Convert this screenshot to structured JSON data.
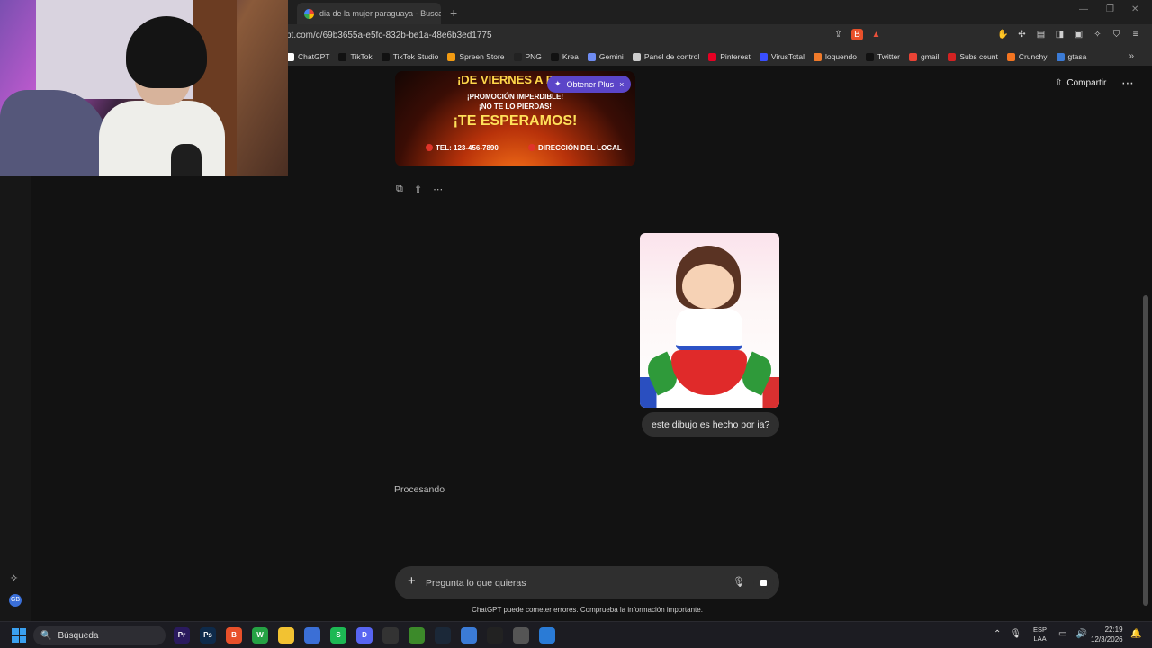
{
  "browser": {
    "tab_title": "dia de la mujer paraguaya - Buscar c",
    "new_tab": "+",
    "url": "pt.com/c/69b3655a-e5fc-832b-be1a-48e6b3ed1775",
    "bookmarks": [
      {
        "label": "ChatGPT",
        "color": "#ffffff"
      },
      {
        "label": "TikTok",
        "color": "#111111"
      },
      {
        "label": "TikTok Studio",
        "color": "#111111"
      },
      {
        "label": "Spreen Store",
        "color": "#f29b12"
      },
      {
        "label": "PNG",
        "color": "#222222"
      },
      {
        "label": "Krea",
        "color": "#111111"
      },
      {
        "label": "Gemini",
        "color": "#6f8cf2"
      },
      {
        "label": "Panel de control",
        "color": "#cccccc"
      },
      {
        "label": "Pinterest",
        "color": "#e60023"
      },
      {
        "label": "VirusTotal",
        "color": "#394eff"
      },
      {
        "label": "loquendo",
        "color": "#f07a2a"
      },
      {
        "label": "Twitter",
        "color": "#111111"
      },
      {
        "label": "gmail",
        "color": "#ea4335"
      },
      {
        "label": "Subs count",
        "color": "#d32222"
      },
      {
        "label": "Crunchy",
        "color": "#f47521"
      },
      {
        "label": "gtasa",
        "color": "#3b7bd6"
      }
    ],
    "more_bookmarks": "»"
  },
  "chat": {
    "share_label": "Compartir",
    "more_icon": "⋯",
    "upgrade_label": "Obtener Plus",
    "upgrade_close": "×",
    "promo": {
      "line1": "¡DE VIERNES A DOM",
      "line2": "¡PROMOCIÓN IMPERDIBLE!",
      "line3": "¡NO TE LO PIERDAS!",
      "line4": "¡TE ESPERAMOS!",
      "phone": "TEL: 123-456-7890",
      "address": "DIRECCIÓN DEL LOCAL"
    },
    "user_message": "este dibujo es hecho por ia?",
    "status": "Procesando",
    "composer_placeholder": "Pregunta lo que quieras",
    "disclaimer": "ChatGPT puede cometer errores. Comprueba la información importante.",
    "avatar_initials": "GB"
  },
  "taskbar": {
    "search_label": "Búsqueda",
    "apps": [
      {
        "name": "Premiere",
        "label": "Pr",
        "color": "#2a1a5e"
      },
      {
        "name": "Photoshop",
        "label": "Ps",
        "color": "#0e2a4a"
      },
      {
        "name": "Brave",
        "label": "B",
        "color": "#e8502a"
      },
      {
        "name": "WhatsApp",
        "label": "W",
        "color": "#25a244"
      },
      {
        "name": "Explorer",
        "label": "",
        "color": "#f2c232"
      },
      {
        "name": "Store",
        "label": "",
        "color": "#3b6fd6"
      },
      {
        "name": "Spotify",
        "label": "S",
        "color": "#1db954"
      },
      {
        "name": "Discord",
        "label": "D",
        "color": "#5865f2"
      },
      {
        "name": "ChatGPT",
        "label": "",
        "color": "#333333"
      },
      {
        "name": "Minecraft",
        "label": "",
        "color": "#3c8a2a"
      },
      {
        "name": "Steam",
        "label": "",
        "color": "#1b2838"
      },
      {
        "name": "Notepad",
        "label": "",
        "color": "#3b7bd6"
      },
      {
        "name": "OBS",
        "label": "",
        "color": "#222222"
      },
      {
        "name": "Settings",
        "label": "",
        "color": "#555555"
      },
      {
        "name": "Photos",
        "label": "",
        "color": "#2a7bd6"
      }
    ],
    "lang_line1": "ESP",
    "lang_line2": "LAA",
    "time": "22:19",
    "date": "12/3/2026"
  }
}
